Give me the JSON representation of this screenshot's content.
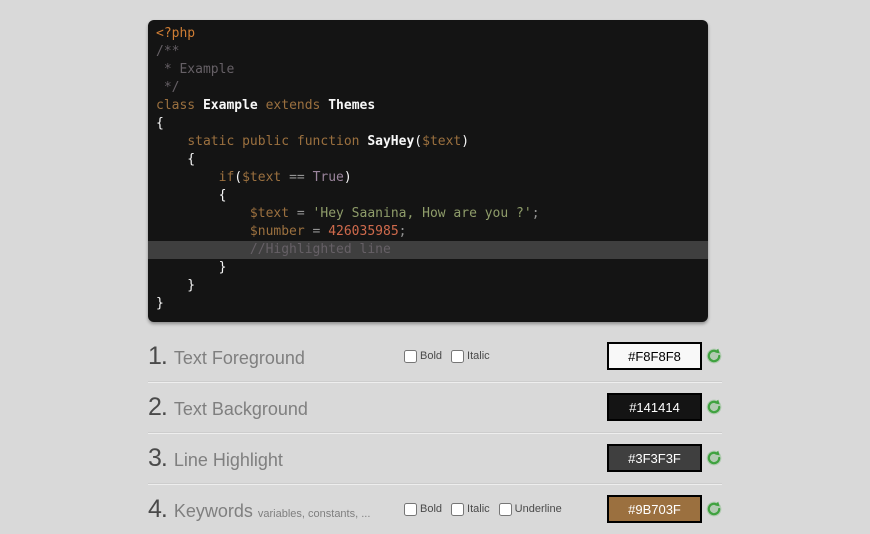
{
  "code_preview": {
    "background": "#141414",
    "foreground": "#F8F8F8",
    "line_highlight": "#3F3F3F",
    "token_colors": {
      "tag": "#CF7D34",
      "comment": "#666066",
      "keyword": "#9B703F",
      "plain": "#F8F8F8",
      "bold": "#F8F8F8",
      "string": "#8F9D6A",
      "number": "#CF6A4C",
      "constant": "#9B859D",
      "operator": "#949494"
    },
    "lines": [
      {
        "tokens": [
          [
            "tag",
            "<?php"
          ]
        ]
      },
      {
        "tokens": [
          [
            "comment",
            "/**"
          ]
        ]
      },
      {
        "tokens": [
          [
            "comment",
            " * Example"
          ]
        ]
      },
      {
        "tokens": [
          [
            "comment",
            " */"
          ]
        ]
      },
      {
        "tokens": [
          [
            "keyword",
            "class"
          ],
          [
            "plain",
            " "
          ],
          [
            "bold",
            "Example"
          ],
          [
            "plain",
            " "
          ],
          [
            "keyword",
            "extends"
          ],
          [
            "plain",
            " "
          ],
          [
            "bold",
            "Themes"
          ]
        ]
      },
      {
        "tokens": [
          [
            "plain",
            "{"
          ]
        ]
      },
      {
        "tokens": [
          [
            "plain",
            "    "
          ],
          [
            "keyword",
            "static public function"
          ],
          [
            "plain",
            " "
          ],
          [
            "bold",
            "SayHey"
          ],
          [
            "plain",
            "("
          ],
          [
            "keyword",
            "$text"
          ],
          [
            "plain",
            ")"
          ]
        ]
      },
      {
        "tokens": [
          [
            "plain",
            "    {"
          ]
        ]
      },
      {
        "tokens": [
          [
            "plain",
            "        "
          ],
          [
            "keyword",
            "if"
          ],
          [
            "plain",
            "("
          ],
          [
            "keyword",
            "$text"
          ],
          [
            "plain",
            " "
          ],
          [
            "operator",
            "=="
          ],
          [
            "plain",
            " "
          ],
          [
            "constant",
            "True"
          ],
          [
            "plain",
            ")"
          ]
        ]
      },
      {
        "tokens": [
          [
            "plain",
            "        {"
          ]
        ]
      },
      {
        "tokens": [
          [
            "plain",
            "            "
          ],
          [
            "keyword",
            "$text"
          ],
          [
            "plain",
            " "
          ],
          [
            "operator",
            "="
          ],
          [
            "plain",
            " "
          ],
          [
            "string",
            "'Hey Saanina, How are you ?'"
          ],
          [
            "operator",
            ";"
          ]
        ]
      },
      {
        "tokens": [
          [
            "plain",
            "            "
          ],
          [
            "keyword",
            "$number"
          ],
          [
            "plain",
            " "
          ],
          [
            "operator",
            "="
          ],
          [
            "plain",
            " "
          ],
          [
            "number",
            "426035985"
          ],
          [
            "operator",
            ";"
          ]
        ]
      },
      {
        "highlight": true,
        "tokens": [
          [
            "plain",
            "            "
          ],
          [
            "comment",
            "//Highlighted line"
          ]
        ]
      },
      {
        "tokens": [
          [
            "plain",
            "        }"
          ]
        ]
      },
      {
        "tokens": [
          [
            "plain",
            "    }"
          ]
        ]
      },
      {
        "tokens": [
          [
            "plain",
            "}"
          ]
        ]
      }
    ]
  },
  "settings": {
    "reset_icon_color": "#3FA23F",
    "rows": [
      {
        "num": "1.",
        "label": "Text Foreground",
        "sub": "",
        "checkboxes": [
          "Bold",
          "Italic"
        ],
        "color": "#F8F8F8",
        "value_text_color": "#000000"
      },
      {
        "num": "2.",
        "label": "Text Background",
        "sub": "",
        "checkboxes": [],
        "color": "#141414",
        "value_text_color": "#FFFFFF"
      },
      {
        "num": "3.",
        "label": "Line Highlight",
        "sub": "",
        "checkboxes": [],
        "color": "#3F3F3F",
        "value_text_color": "#FFFFFF"
      },
      {
        "num": "4.",
        "label": "Keywords",
        "sub": "variables, constants, ...",
        "checkboxes": [
          "Bold",
          "Italic",
          "Underline"
        ],
        "color": "#9B703F",
        "value_text_color": "#FFFFFF"
      }
    ]
  }
}
